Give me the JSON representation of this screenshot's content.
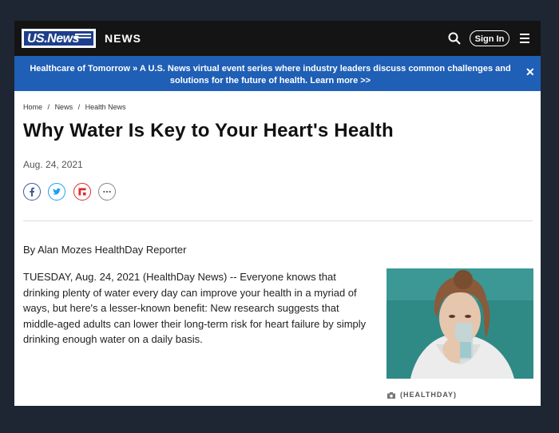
{
  "header": {
    "logo_text": "US.News",
    "section": "NEWS",
    "signin_label": "Sign In",
    "icons": [
      "search-icon",
      "menu-icon"
    ]
  },
  "banner": {
    "lead": "Healthcare of Tomorrow »",
    "text": "A U.S. News virtual event series where industry leaders discuss common challenges and solutions for the future of health. Learn more >>",
    "close": "✕"
  },
  "breadcrumbs": [
    "Home",
    "/",
    "News",
    "/",
    "Health News"
  ],
  "article": {
    "title": "Why Water Is Key to Your Heart's Health",
    "date": "Aug. 24, 2021",
    "byline": "By Alan Mozes HealthDay Reporter",
    "body": "TUESDAY, Aug. 24, 2021 (HealthDay News) -- Everyone knows that drinking plenty of water every day can improve your health in a myriad of ways, but here's a lesser-known benefit: New research suggests that middle-aged adults can lower their long-term risk for heart failure by simply drinking enough water on a daily basis.",
    "caption": "(HEALTHDAY)"
  },
  "share": [
    {
      "name": "facebook-icon",
      "glyph": "f",
      "color": "#3b5998"
    },
    {
      "name": "twitter-icon",
      "glyph": "t",
      "color": "#1da1f2"
    },
    {
      "name": "flipboard-icon",
      "glyph": "F",
      "color": "#e12828"
    },
    {
      "name": "more-icon",
      "glyph": "•••",
      "color": "#666666"
    }
  ],
  "colors": {
    "topbar": "#141414",
    "banner": "#1f5fb5",
    "logo_blue": "#1d3f8c",
    "outer_bg": "#1e2633"
  }
}
